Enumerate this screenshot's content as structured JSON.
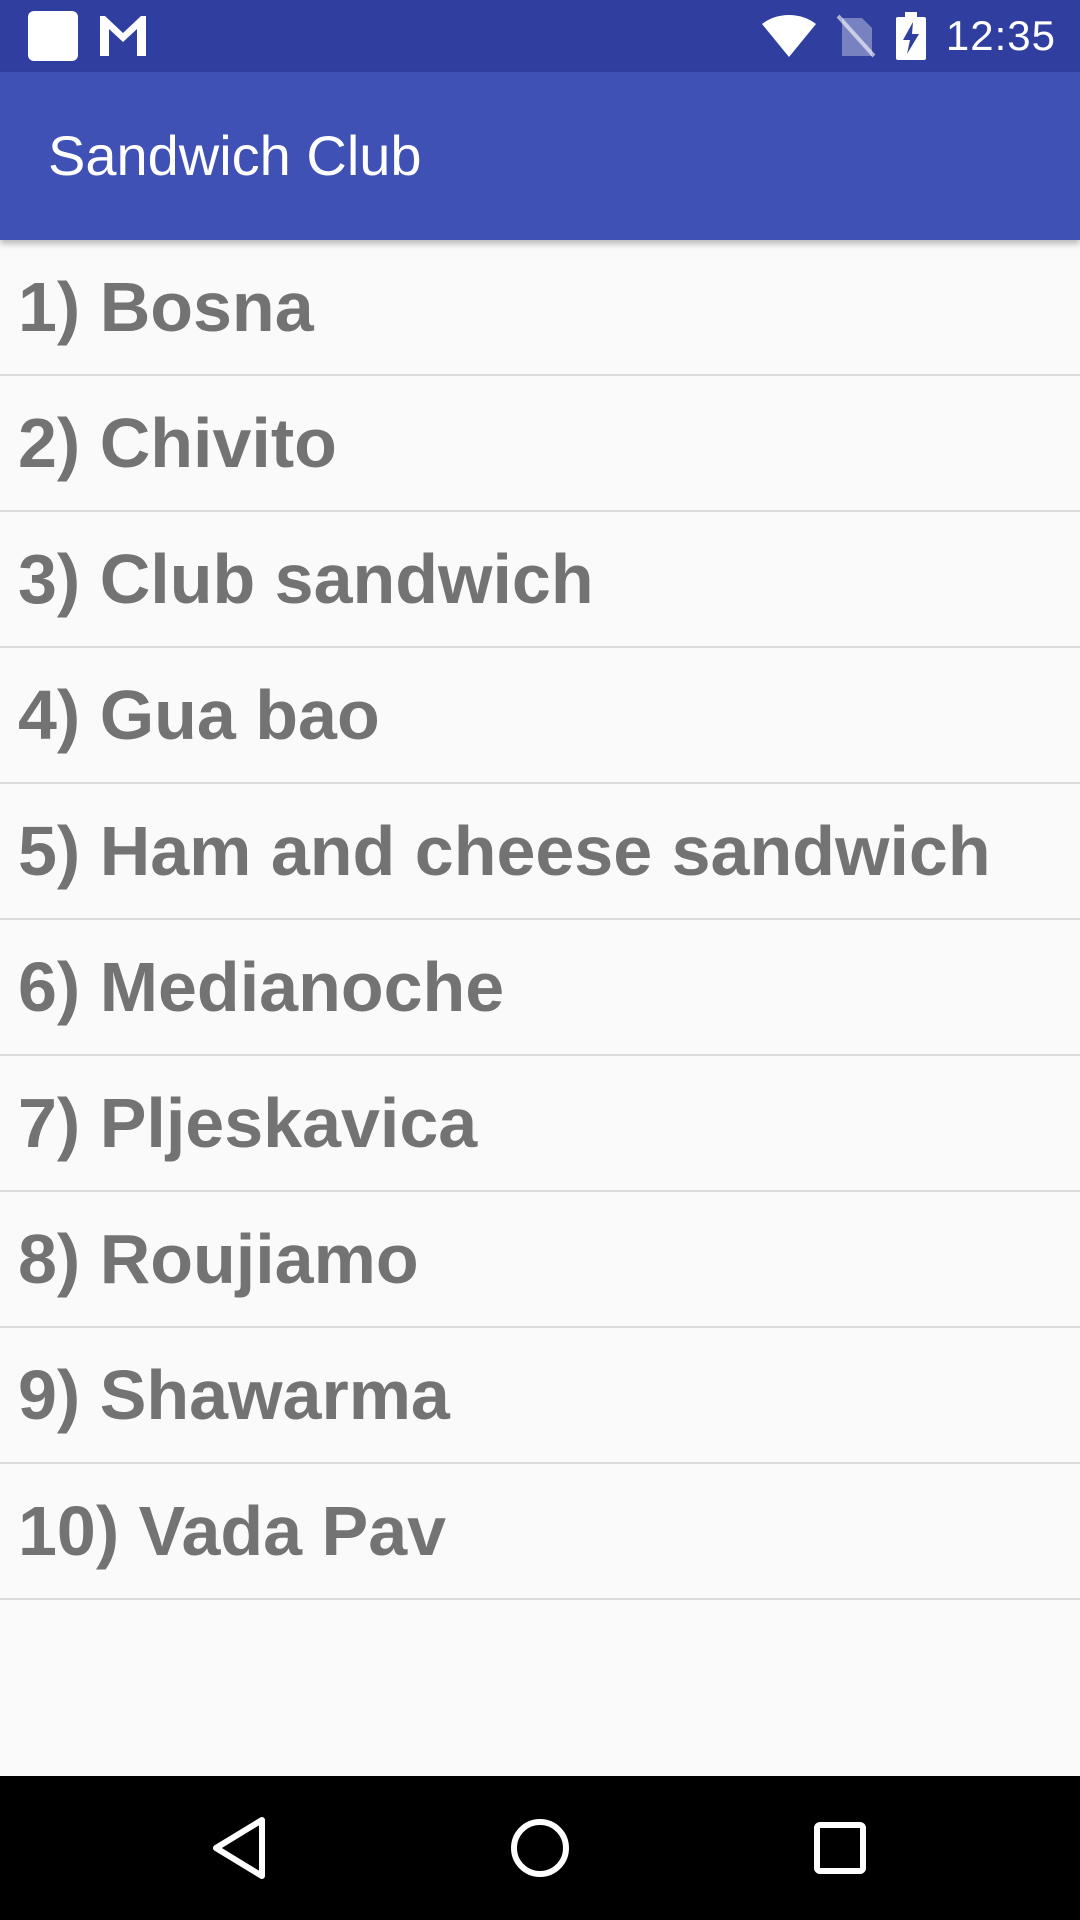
{
  "status_bar": {
    "time": "12:35",
    "left_icons": [
      "notification-square-icon",
      "gmail-icon"
    ],
    "right_icons": [
      "wifi-icon",
      "no-sim-icon",
      "battery-charging-icon"
    ],
    "background": "#303f9f"
  },
  "app_bar": {
    "title": "Sandwich Club",
    "background": "#3f51b5"
  },
  "sandwiches": [
    "1) Bosna",
    "2) Chivito",
    "3) Club sandwich",
    "4) Gua bao",
    "5) Ham and cheese sandwich",
    "6) Medianoche",
    "7) Pljeskavica",
    "8) Roujiamo",
    "9) Shawarma",
    "10) Vada Pav"
  ],
  "colors": {
    "list_text": "#737373",
    "list_background": "#fafafa",
    "divider": "#dcdcdc"
  },
  "nav_bar": {
    "buttons": [
      "back-icon",
      "home-icon",
      "recents-icon"
    ]
  }
}
